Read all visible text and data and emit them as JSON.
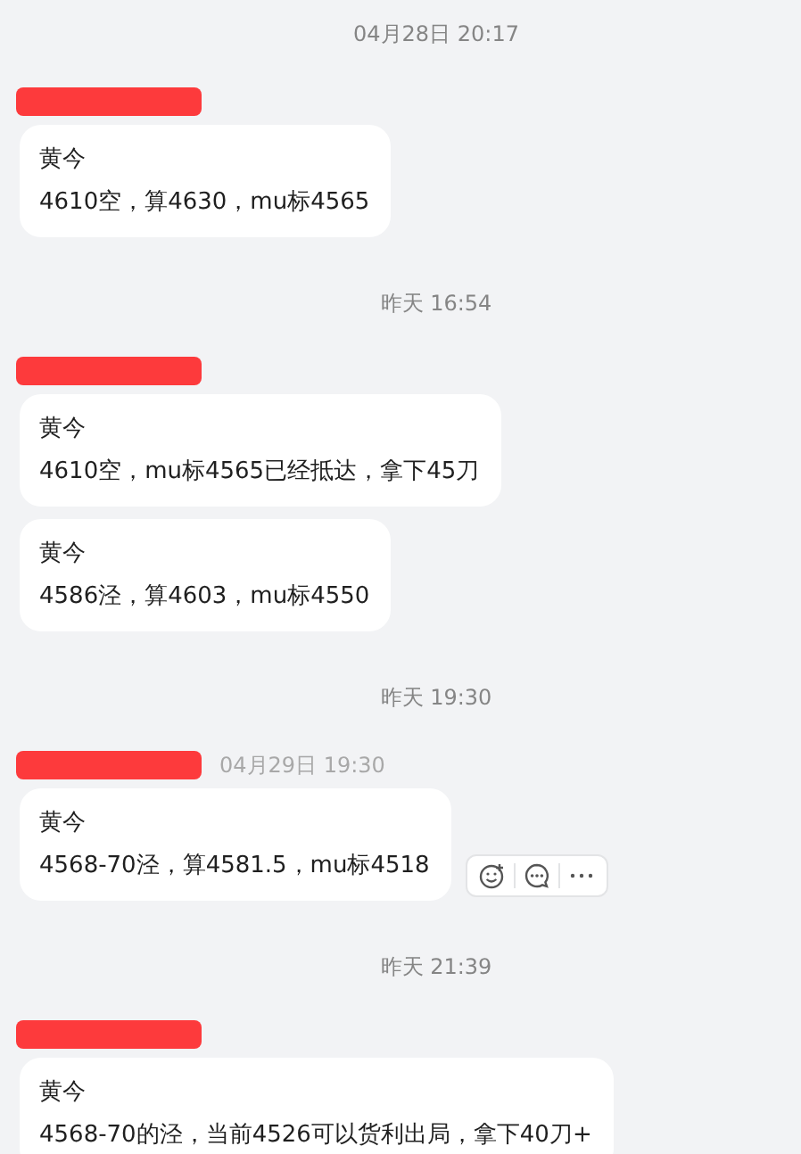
{
  "messages": [
    {
      "timestamp": "04月28日 20:17",
      "sender": {
        "redacted": true
      },
      "bubbles": [
        {
          "title": "黄今",
          "text": "4610空，算4630，mu标4565",
          "hovered": false
        }
      ]
    },
    {
      "timestamp": "昨天 16:54",
      "sender": {
        "redacted": true
      },
      "bubbles": [
        {
          "title": "黄今",
          "text": "4610空，mu标4565已经抵达，拿下45刀",
          "hovered": false
        },
        {
          "title": "黄今",
          "text": "4586泾，算4603，mu标4550",
          "hovered": false
        }
      ]
    },
    {
      "timestamp": "昨天 19:30",
      "sender": {
        "redacted": true,
        "time": "04月29日 19:30"
      },
      "bubbles": [
        {
          "title": "黄今",
          "text": "4568-70泾，算4581.5，mu标4518",
          "hovered": true
        }
      ]
    },
    {
      "timestamp": "昨天 21:39",
      "sender": {
        "redacted": true
      },
      "bubbles": [
        {
          "title": "黄今",
          "text": "4568-70的泾，当前4526可以货利出局，拿下40刀+",
          "hovered": false
        }
      ]
    }
  ]
}
